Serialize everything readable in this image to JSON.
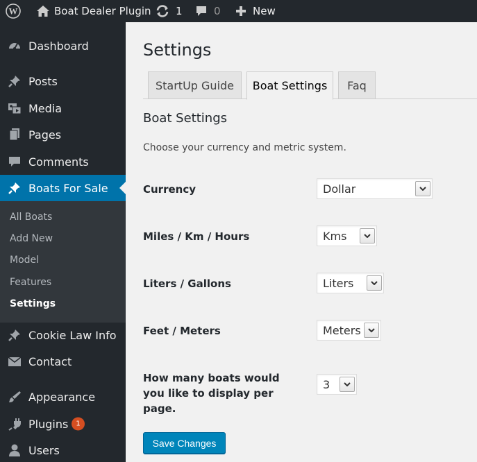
{
  "admin_bar": {
    "site_name": "Boat Dealer Plugin",
    "updates_count": "1",
    "comments_count": "0",
    "new_label": "New"
  },
  "sidebar": {
    "items": [
      {
        "label": "Dashboard",
        "icon": "dashboard-icon"
      },
      {
        "label": "Posts",
        "icon": "pin-icon"
      },
      {
        "label": "Media",
        "icon": "media-icon"
      },
      {
        "label": "Pages",
        "icon": "pages-icon"
      },
      {
        "label": "Comments",
        "icon": "comment-icon"
      },
      {
        "label": "Boats For Sale",
        "icon": "pin-icon",
        "current": true
      },
      {
        "label": "Cookie Law Info",
        "icon": "pin-icon"
      },
      {
        "label": "Contact",
        "icon": "envelope-icon"
      },
      {
        "label": "Appearance",
        "icon": "brush-icon"
      },
      {
        "label": "Plugins",
        "icon": "plug-icon",
        "badge": "1"
      },
      {
        "label": "Users",
        "icon": "user-icon"
      }
    ],
    "submenu": [
      "All Boats",
      "Add New",
      "Model",
      "Features",
      "Settings"
    ],
    "active_submenu": "Settings"
  },
  "main": {
    "page_title": "Settings",
    "tabs": [
      {
        "label": "StartUp Guide"
      },
      {
        "label": "Boat Settings",
        "active": true
      },
      {
        "label": "Faq"
      }
    ],
    "section_title": "Boat Settings",
    "description": "Choose your currency and metric system.",
    "fields": [
      {
        "label": "Currency",
        "value": "Dollar"
      },
      {
        "label": "Miles / Km / Hours",
        "value": "Kms"
      },
      {
        "label": "Liters / Gallons",
        "value": "Liters"
      },
      {
        "label": "Feet / Meters",
        "value": "Meters"
      },
      {
        "label": "How many boats would you like to display per page.",
        "value": "3"
      }
    ],
    "save_label": "Save Changes"
  },
  "colors": {
    "adminbar_bg": "#23282d",
    "sidebar_bg": "#23282d",
    "submenu_bg": "#32373c",
    "current_bg": "#0073aa",
    "button_bg": "#0085ba",
    "badge_bg": "#d54e21"
  }
}
